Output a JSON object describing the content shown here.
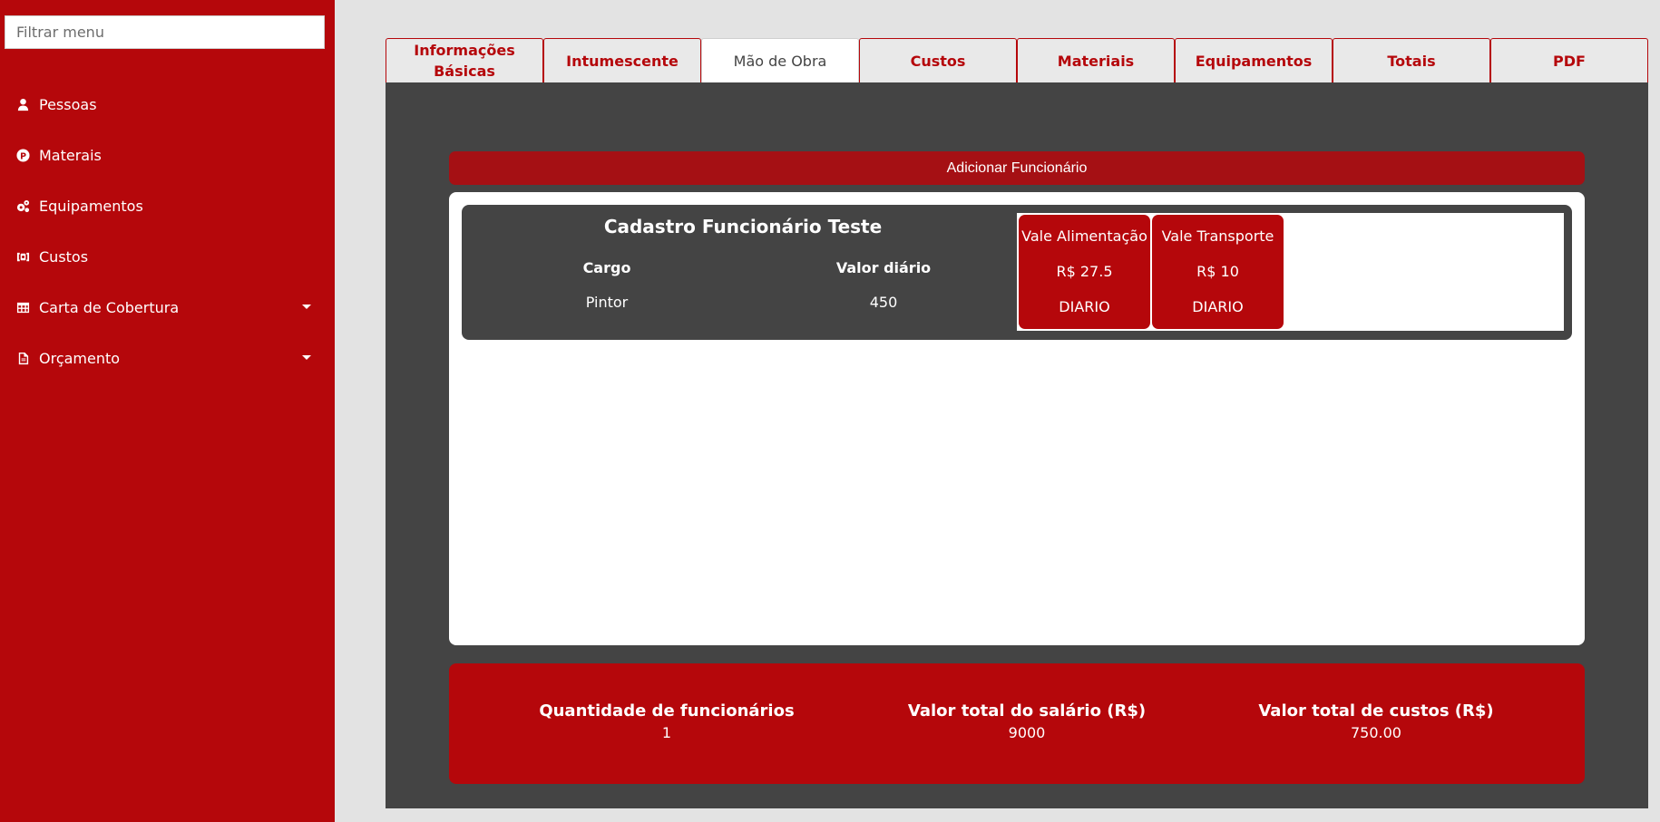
{
  "sidebar": {
    "filter_placeholder": "Filtrar menu",
    "items": [
      {
        "label": "Pessoas",
        "icon": "user-icon",
        "has_caret": false
      },
      {
        "label": "Materais",
        "icon": "product-icon",
        "has_caret": false
      },
      {
        "label": "Equipamentos",
        "icon": "cogs-icon",
        "has_caret": false
      },
      {
        "label": "Custos",
        "icon": "money-icon",
        "has_caret": false
      },
      {
        "label": "Carta de Cobertura",
        "icon": "table-icon",
        "has_caret": true
      },
      {
        "label": "Orçamento",
        "icon": "document-icon",
        "has_caret": true
      }
    ]
  },
  "tabs": [
    {
      "label": "Informações Básicas",
      "active": false
    },
    {
      "label": "Intumescente",
      "active": false
    },
    {
      "label": "Mão de Obra",
      "active": true
    },
    {
      "label": "Custos",
      "active": false
    },
    {
      "label": "Materiais",
      "active": false
    },
    {
      "label": "Equipamentos",
      "active": false
    },
    {
      "label": "Totais",
      "active": false
    },
    {
      "label": "PDF",
      "active": false
    }
  ],
  "main": {
    "add_button_label": "Adicionar Funcionário",
    "employee": {
      "name": "Cadastro Funcionário Teste",
      "cargo_label": "Cargo",
      "cargo_value": "Pintor",
      "valor_label": "Valor diário",
      "valor_value": "450",
      "benefits": [
        {
          "title": "Vale Alimentação",
          "value": "R$ 27.5",
          "frequency": "DIARIO"
        },
        {
          "title": "Vale Transporte",
          "value": "R$ 10",
          "frequency": "DIARIO"
        }
      ]
    },
    "totals": {
      "employees_label": "Quantidade de funcionários",
      "employees_value": "1",
      "salary_label": "Valor total do salário (R$)",
      "salary_value": "9000",
      "costs_label": "Valor total de custos (R$)",
      "costs_value": "750.00"
    }
  },
  "colors": {
    "brand_red": "#b5070b",
    "panel_gray": "#444444",
    "background": "#e3e3e3"
  }
}
